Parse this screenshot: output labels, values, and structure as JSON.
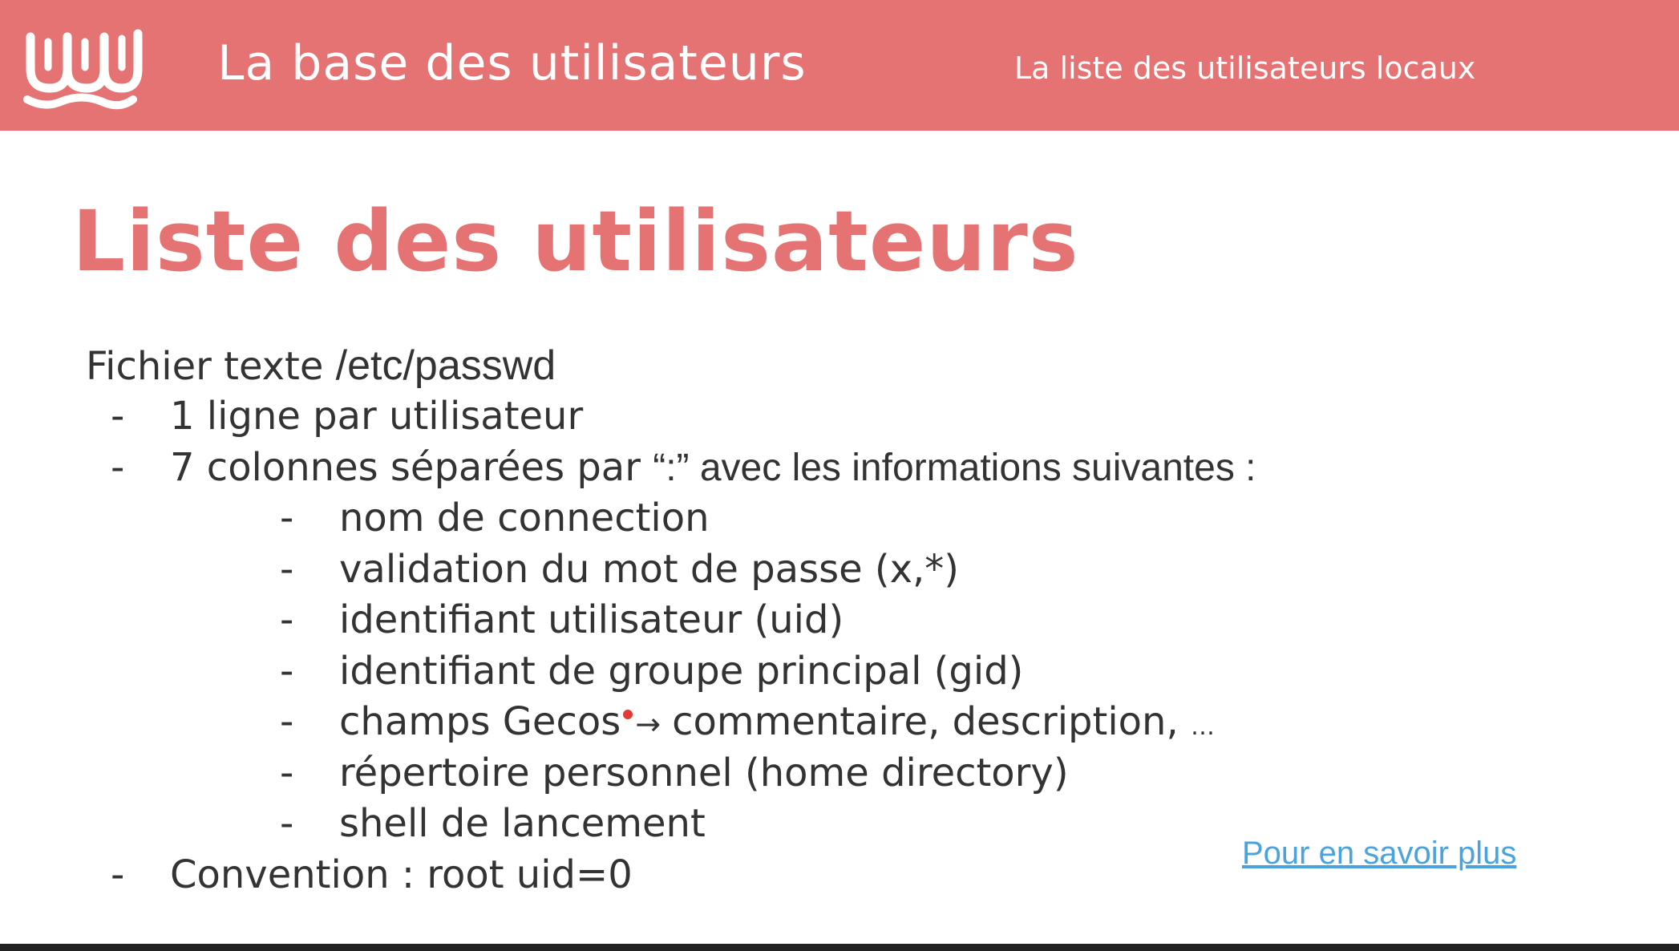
{
  "header": {
    "logo_icon": "wavy-lines-logo-icon",
    "title": "La base des utilisateurs",
    "subtitle": "La liste des utilisateurs locaux",
    "background_color": "#e57373"
  },
  "slide": {
    "title": "Liste des utilisateurs",
    "title_color": "#e57373",
    "intro": {
      "text": "Fichier texte ",
      "path": "/etc/passwd"
    },
    "bullets": {
      "line1": "1 ligne par utilisateur",
      "line2_part1": "7 colonnes séparées par ",
      "line2_part2": "“:” avec les informations suivantes :",
      "dash": "-",
      "columns": {
        "c1": "nom de connection",
        "c2": "validation du mot de passe (x,*)",
        "c3": "identifiant utilisateur (uid)",
        "c4": "identifiant de groupe principal (gid)",
        "c5_part1": "champs Gecos",
        "c5_arrow": "→",
        "c5_part2": "commentaire, description, ",
        "c5_ellipsis": "…",
        "c6": "répertoire personnel (home directory)",
        "c7": "shell de lancement"
      },
      "convention": "Convention : root uid=0"
    },
    "link": {
      "label": "Pour en savoir plus",
      "color": "#4aa3df"
    }
  }
}
